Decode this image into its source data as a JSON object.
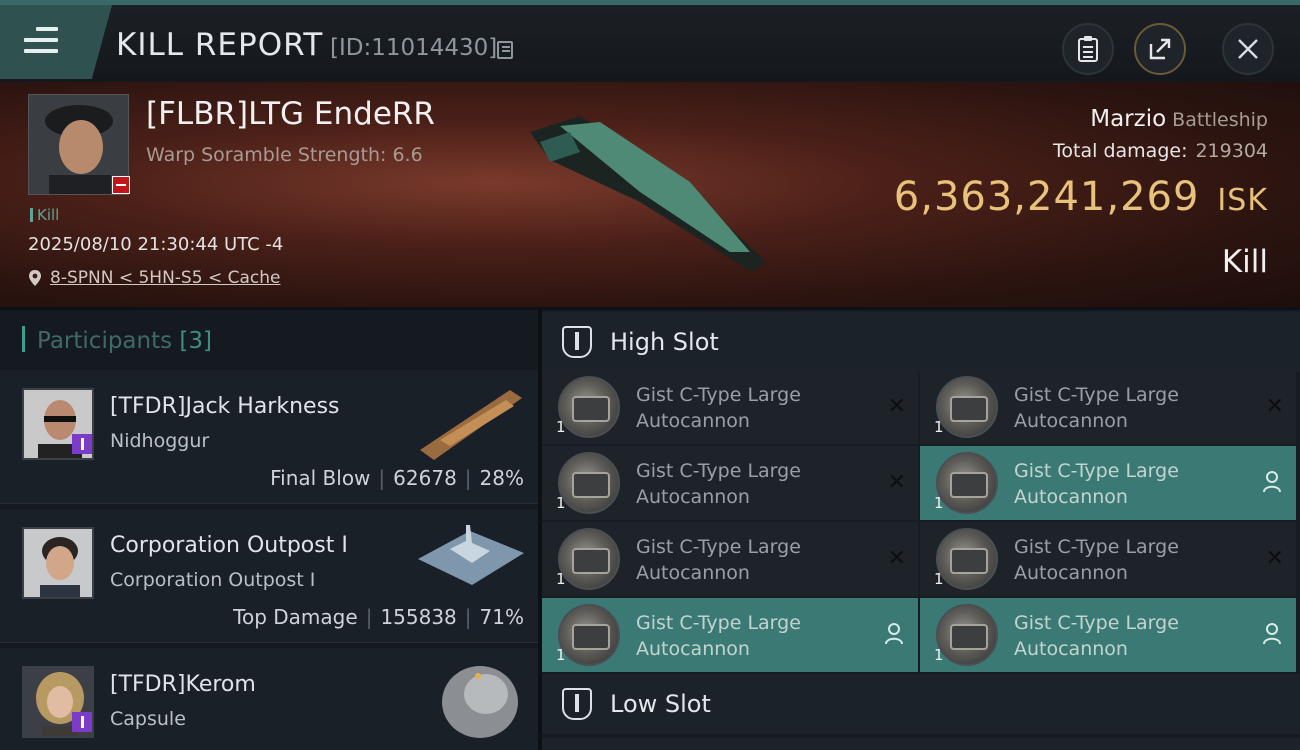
{
  "header": {
    "title": "KILL REPORT",
    "report_id": "[ID:11014430]",
    "icons": [
      "menu-icon",
      "copy-icon",
      "clipboard-icon",
      "share-icon",
      "close-icon"
    ]
  },
  "victim": {
    "name": "[FLBR]LTG EndeRR",
    "scramble": "Warp Soramble Strength: 6.6",
    "kill_tag": "Kill",
    "datetime": "2025/08/10 21:30:44 UTC -4",
    "location": "8-SPNN < 5HN-S5 < Cache",
    "ship_name": "Marzio",
    "ship_class": "Battleship",
    "total_damage_label": "Total damage:",
    "total_damage": "219304",
    "isk_value": "6,363,241,269",
    "isk_unit": "ISK",
    "status": "Kill"
  },
  "participants": {
    "label": "Participants",
    "count": "[3]",
    "items": [
      {
        "name": "[TFDR]Jack Harkness",
        "ship": "Nidhoggur",
        "role": "Final Blow",
        "damage": "62678",
        "percent": "28%"
      },
      {
        "name": "Corporation Outpost I",
        "ship": "Corporation Outpost I",
        "role": "Top Damage",
        "damage": "155838",
        "percent": "71%"
      },
      {
        "name": "[TFDR]Kerom",
        "ship": "Capsule",
        "role": "",
        "damage": "",
        "percent": ""
      }
    ]
  },
  "slots": {
    "high_label": "High Slot",
    "low_label": "Low Slot",
    "modules": [
      {
        "name_line1": "Gist C-Type Large",
        "name_line2": "Autocannon",
        "qty": "1",
        "state": "destroyed"
      },
      {
        "name_line1": "Gist C-Type Large",
        "name_line2": "Autocannon",
        "qty": "1",
        "state": "destroyed"
      },
      {
        "name_line1": "Gist C-Type Large",
        "name_line2": "Autocannon",
        "qty": "1",
        "state": "destroyed"
      },
      {
        "name_line1": "Gist C-Type Large",
        "name_line2": "Autocannon",
        "qty": "1",
        "state": "dropped"
      },
      {
        "name_line1": "Gist C-Type Large",
        "name_line2": "Autocannon",
        "qty": "1",
        "state": "destroyed"
      },
      {
        "name_line1": "Gist C-Type Large",
        "name_line2": "Autocannon",
        "qty": "1",
        "state": "destroyed"
      },
      {
        "name_line1": "Gist C-Type Large",
        "name_line2": "Autocannon",
        "qty": "1",
        "state": "dropped"
      },
      {
        "name_line1": "Gist C-Type Large",
        "name_line2": "Autocannon",
        "qty": "1",
        "state": "dropped"
      }
    ]
  },
  "colors": {
    "accent_teal": "#3b7a74",
    "isk_gold": "#e8c27a",
    "badge_red": "#c0171c",
    "badge_purple": "#7d3bc9"
  }
}
